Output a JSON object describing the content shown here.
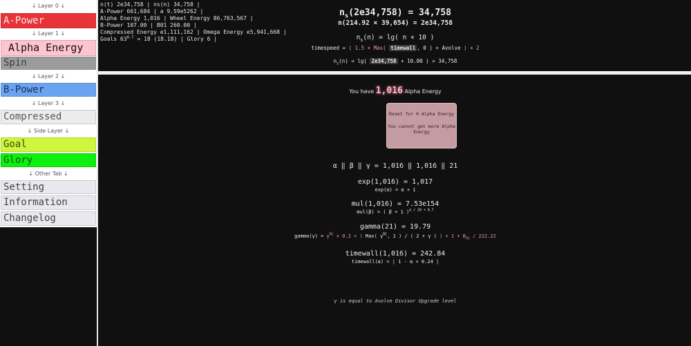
{
  "sidebar": {
    "layer0_label": "↓ Layer 0 ↓",
    "apower": "A-Power",
    "layer1_label": "↓ Layer 1 ↓",
    "alpha": "Alpha Energy",
    "spin": "Spin",
    "layer2_label": "↓ Layer 2 ↓",
    "bpower": "B-Power",
    "layer3_label": "↓ Layer 3 ↓",
    "compressed": "Compressed",
    "side_layer_label": "↓ Side Layer ↓",
    "goal": "Goal",
    "glory": "Glory",
    "other_tab_label": "↓ Other Tab ↓",
    "setting": "Setting",
    "information": "Information",
    "changelog": "Changelog"
  },
  "stats": {
    "line1": "n(t) 2e34,758 | ns(n) 34,758 |",
    "line2": "A-Power 661,684 | a 9.59e5262 |",
    "line3": "Alpha Energy 1,016 | Wheel Energy 86,763,567 |",
    "line4": "B-Power 107.00 | B01 260.00 |",
    "line5": "Compressed Energy e1,111,162 | Omega Energy e5,941,668 |",
    "line6_pre": "Goals 63",
    "line6_sup": "0.7",
    "line6_post": " = 18 (18.18) | Glory 6 |"
  },
  "top": {
    "ns_title_pre": "n",
    "ns_title_sub": "s",
    "ns_title_post": "(2e34,758) = 34,758",
    "ns_sub": "n(214.92 × 39,654) = 2e34,758",
    "ns_formula_pre": "n",
    "ns_formula_sub": "s",
    "ns_formula_post": "(n) = lg( n + 10 )",
    "timespeed_label": "timespeed = ",
    "timespeed_open": "( 1.5 × Max( ",
    "timespeed_var": "timewall",
    "timespeed_mid": ", 0 ) + Avolve ",
    "timespeed_close": ") × 2",
    "ns_eval_pre": "n",
    "ns_eval_sub": "s",
    "ns_eval_mid": "(n) = lg( ",
    "ns_eval_hl": "2e34,758",
    "ns_eval_post": " + 10.00 ) = 34,758"
  },
  "main": {
    "have_pre": "You have ",
    "have_num": "1,016",
    "have_post": " Alpha Energy",
    "reset_line1": "Reset for 0 Alpha Energy",
    "reset_line2": "You cannot get more Alpha Energy",
    "abc": "α ‖ β ‖ γ = 1,016 ‖ 1,016 ‖ 21",
    "exp_val": "exp(1,016) = 1,017",
    "exp_def": "exp(α) = α + 1",
    "mul_val": "mul(1,016) = 7.53e154",
    "mul_def_pre": "mul(β) = ( β + 1 )",
    "mul_def_sup": "α / 20 + 0.7",
    "gamma_val": "gamma(21) = 19.79",
    "gamma_def_pre": "gamma(γ) = ",
    "gamma_def_g": "γ",
    "gamma_def_rc": "RC",
    "gamma_def_a": " × 0.2 × ( ",
    "gamma_def_b": "Max( γ",
    "gamma_def_rc2": "RC",
    "gamma_def_c": ", 1 ) / ( 2 + γ )",
    "gamma_def_d": " ) + 1 + B",
    "gamma_def_sub": "01",
    "gamma_def_e": " / 222.22",
    "tw_val": "timewall(1,016) = 242.84",
    "tw_def": "timewall(α) = | 1 - α × 0.24 |",
    "note": "γ is equal to Avolve Divisor Upgrade level"
  }
}
